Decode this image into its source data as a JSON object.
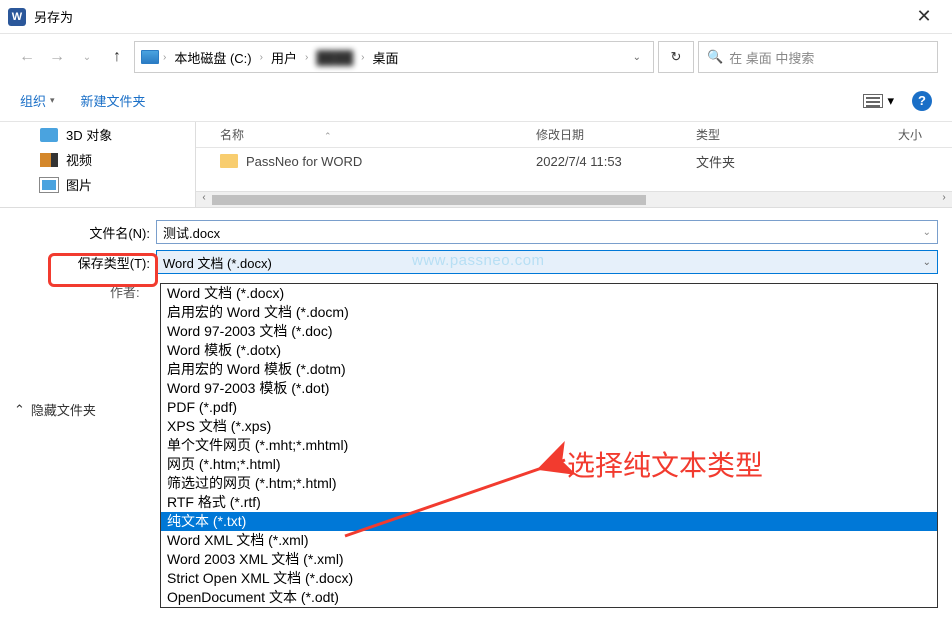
{
  "window": {
    "title": "另存为"
  },
  "breadcrumb": {
    "drive": "本地磁盘 (C:)",
    "users": "用户",
    "blurred": "████",
    "desktop": "桌面"
  },
  "search": {
    "placeholder": "在 桌面 中搜索"
  },
  "toolbar": {
    "organize": "组织",
    "new_folder": "新建文件夹"
  },
  "sidebar": {
    "items": [
      {
        "label": "3D 对象"
      },
      {
        "label": "视频"
      },
      {
        "label": "图片"
      }
    ]
  },
  "filelist": {
    "headers": {
      "name": "名称",
      "date": "修改日期",
      "type": "类型",
      "size": "大小"
    },
    "rows": [
      {
        "name": "PassNeo for WORD",
        "date": "2022/7/4 11:53",
        "type": "文件夹"
      }
    ]
  },
  "form": {
    "filename_label": "文件名(N):",
    "filename_value": "测试.docx",
    "savetype_label": "保存类型(T):",
    "savetype_value": "Word 文档 (*.docx)",
    "author_label": "作者:"
  },
  "filetype_options": [
    "Word 文档 (*.docx)",
    "启用宏的 Word 文档 (*.docm)",
    "Word 97-2003 文档 (*.doc)",
    "Word 模板 (*.dotx)",
    "启用宏的 Word 模板 (*.dotm)",
    "Word 97-2003 模板 (*.dot)",
    "PDF (*.pdf)",
    "XPS 文档 (*.xps)",
    "单个文件网页 (*.mht;*.mhtml)",
    "网页 (*.htm;*.html)",
    "筛选过的网页 (*.htm;*.html)",
    "RTF 格式 (*.rtf)",
    "纯文本 (*.txt)",
    "Word XML 文档 (*.xml)",
    "Word 2003 XML 文档 (*.xml)",
    "Strict Open XML 文档 (*.docx)",
    "OpenDocument 文本 (*.odt)"
  ],
  "selected_type_index": 12,
  "hide_folders_label": "隐藏文件夹",
  "watermark": "www.passneo.com",
  "annotation": "选择纯文本类型"
}
